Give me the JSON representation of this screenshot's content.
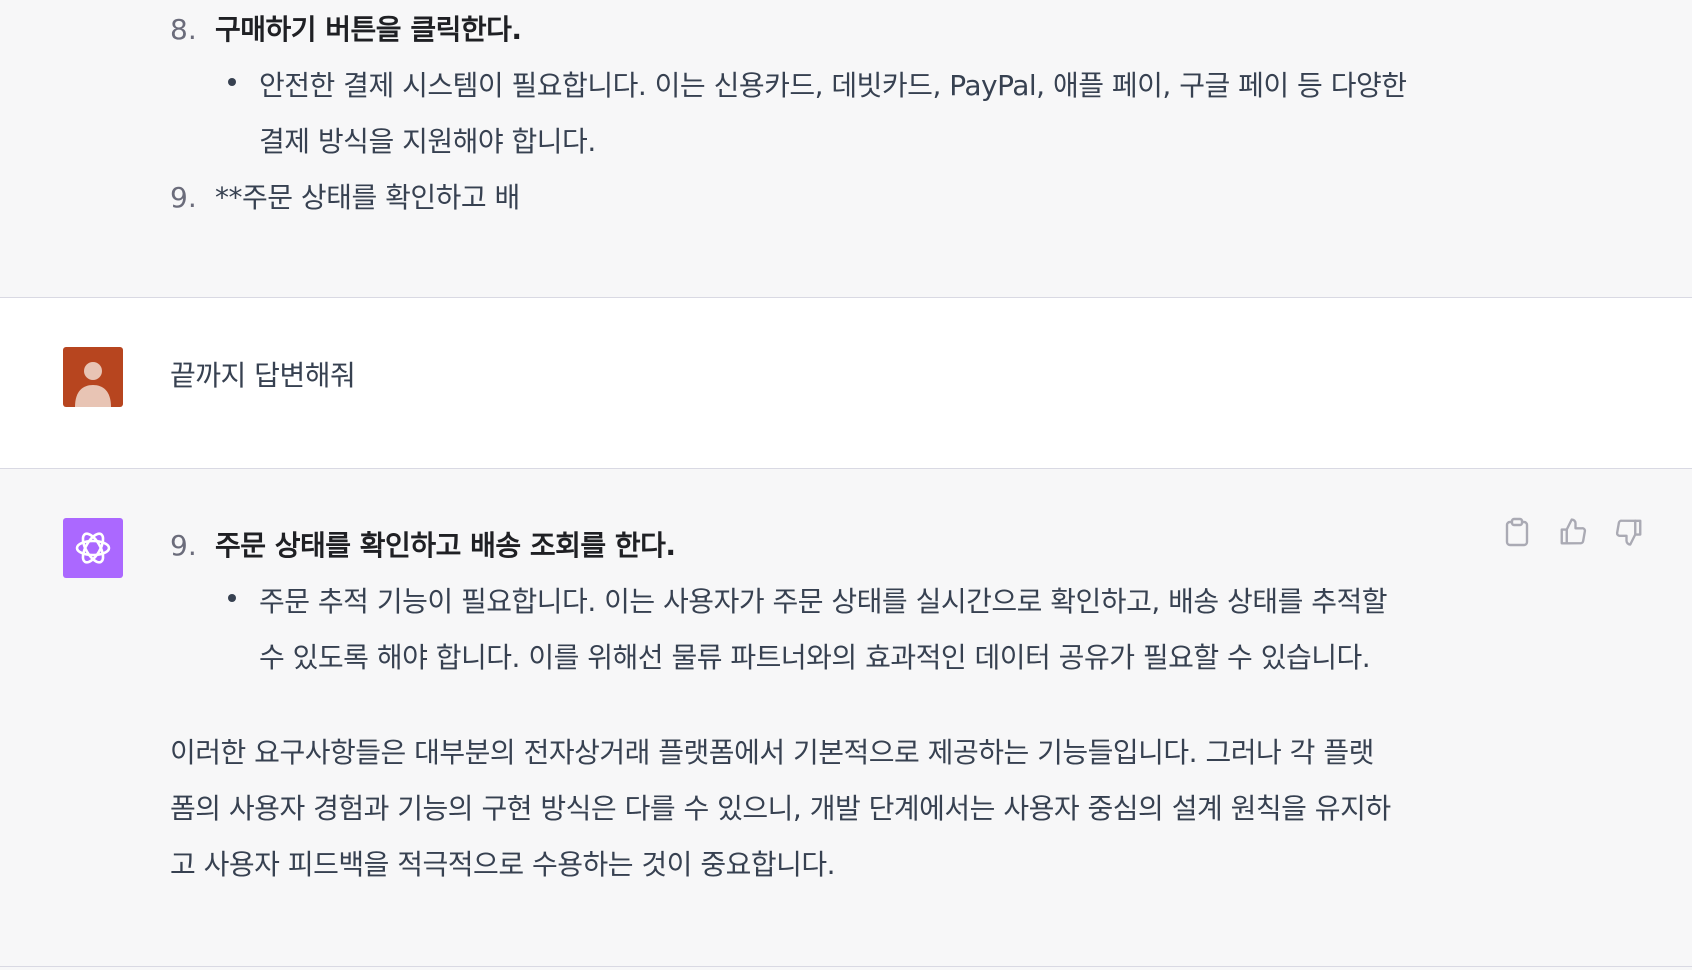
{
  "messages": {
    "assistant_prev": {
      "item8": {
        "number": "8.",
        "title": "구매하기 버튼을 클릭한다.",
        "bullet_line1": "안전한 결제 시스템이 필요합니다. 이는 신용카드, 데빗카드, PayPal, 애플 페이, 구글 페이 등 다양한",
        "bullet_line2": "결제 방식을 지원해야 합니다."
      },
      "item9": {
        "number": "9.",
        "text": "**주문 상태를 확인하고 배"
      }
    },
    "user": {
      "text": "끝까지 답변해줘"
    },
    "assistant": {
      "item9": {
        "number": "9.",
        "title": "주문 상태를 확인하고 배송 조회를 한다.",
        "bullet_line1": "주문 추적 기능이 필요합니다. 이는 사용자가 주문 상태를 실시간으로 확인하고, 배송 상태를 추적할",
        "bullet_line2": "수 있도록 해야 합니다. 이를 위해선 물류 파트너와의 효과적인 데이터 공유가 필요할 수 있습니다."
      },
      "paragraph_line1": "이러한 요구사항들은 대부분의 전자상거래 플랫폼에서 기본적으로 제공하는 기능들입니다. 그러나 각 플랫",
      "paragraph_line2": "폼의 사용자 경험과 기능의 구현 방식은 다를 수 있으니, 개발 단계에서는 사용자 중심의 설계 원칙을 유지하",
      "paragraph_line3": "고 사용자 피드백을 적극적으로 수용하는 것이 중요합니다."
    }
  },
  "icons": {
    "user_avatar": "user-avatar-icon",
    "assistant_avatar": "openai-logo-icon",
    "copy": "clipboard-icon",
    "thumbs_up": "thumbs-up-icon",
    "thumbs_down": "thumbs-down-icon"
  },
  "colors": {
    "user_avatar_bg": "#b7451f",
    "assistant_avatar_bg": "#ab68ff"
  }
}
